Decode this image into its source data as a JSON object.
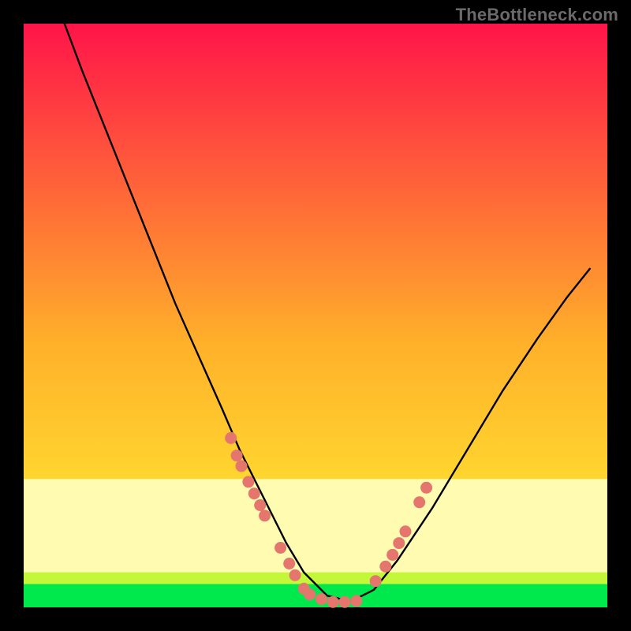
{
  "watermark": "TheBottleneck.com",
  "chart_data": {
    "type": "line",
    "title": "",
    "xlabel": "",
    "ylabel": "",
    "xlim": [
      0,
      100
    ],
    "ylim": [
      0,
      100
    ],
    "series": [
      {
        "name": "curve",
        "x": [
          7,
          10,
          14,
          18,
          22,
          26,
          30,
          34,
          37,
          40,
          43,
          45,
          48,
          52,
          56,
          60,
          64,
          70,
          76,
          82,
          88,
          93,
          97
        ],
        "y": [
          100,
          92,
          82,
          72,
          62,
          52,
          43,
          34,
          27,
          21,
          15,
          11,
          6,
          2,
          1,
          3,
          8,
          17,
          27,
          37,
          46,
          53,
          58
        ]
      }
    ],
    "markers": [
      {
        "x": 35.5,
        "y": 29
      },
      {
        "x": 36.5,
        "y": 26
      },
      {
        "x": 37.3,
        "y": 24.2
      },
      {
        "x": 38.5,
        "y": 21.5
      },
      {
        "x": 39.5,
        "y": 19.5
      },
      {
        "x": 40.5,
        "y": 17.5
      },
      {
        "x": 41.3,
        "y": 15.7
      },
      {
        "x": 44.0,
        "y": 10.2
      },
      {
        "x": 45.5,
        "y": 7.5
      },
      {
        "x": 46.5,
        "y": 5.5
      },
      {
        "x": 48.0,
        "y": 3.2
      },
      {
        "x": 49.0,
        "y": 2.2
      },
      {
        "x": 51.0,
        "y": 1.4
      },
      {
        "x": 53.0,
        "y": 0.9
      },
      {
        "x": 55.0,
        "y": 0.9
      },
      {
        "x": 57.0,
        "y": 1.1
      },
      {
        "x": 60.3,
        "y": 4.5
      },
      {
        "x": 62.0,
        "y": 7.0
      },
      {
        "x": 63.2,
        "y": 9.0
      },
      {
        "x": 64.3,
        "y": 11.0
      },
      {
        "x": 65.4,
        "y": 13.0
      },
      {
        "x": 67.8,
        "y": 18.0
      },
      {
        "x": 69.0,
        "y": 20.5
      }
    ],
    "bands": [
      {
        "name": "green",
        "y0": 0.0,
        "y1": 4.0,
        "color": "#00e94c"
      },
      {
        "name": "yellow-green",
        "y0": 4.0,
        "y1": 6.0,
        "color": "#c3f73a"
      },
      {
        "name": "pale-yellow",
        "y0": 6.0,
        "y1": 22.0,
        "color": "#fffbb0"
      }
    ],
    "gradient_top": "#ff1449",
    "gradient_mid": "#ffb12a",
    "gradient_bottom": "#fff833"
  }
}
